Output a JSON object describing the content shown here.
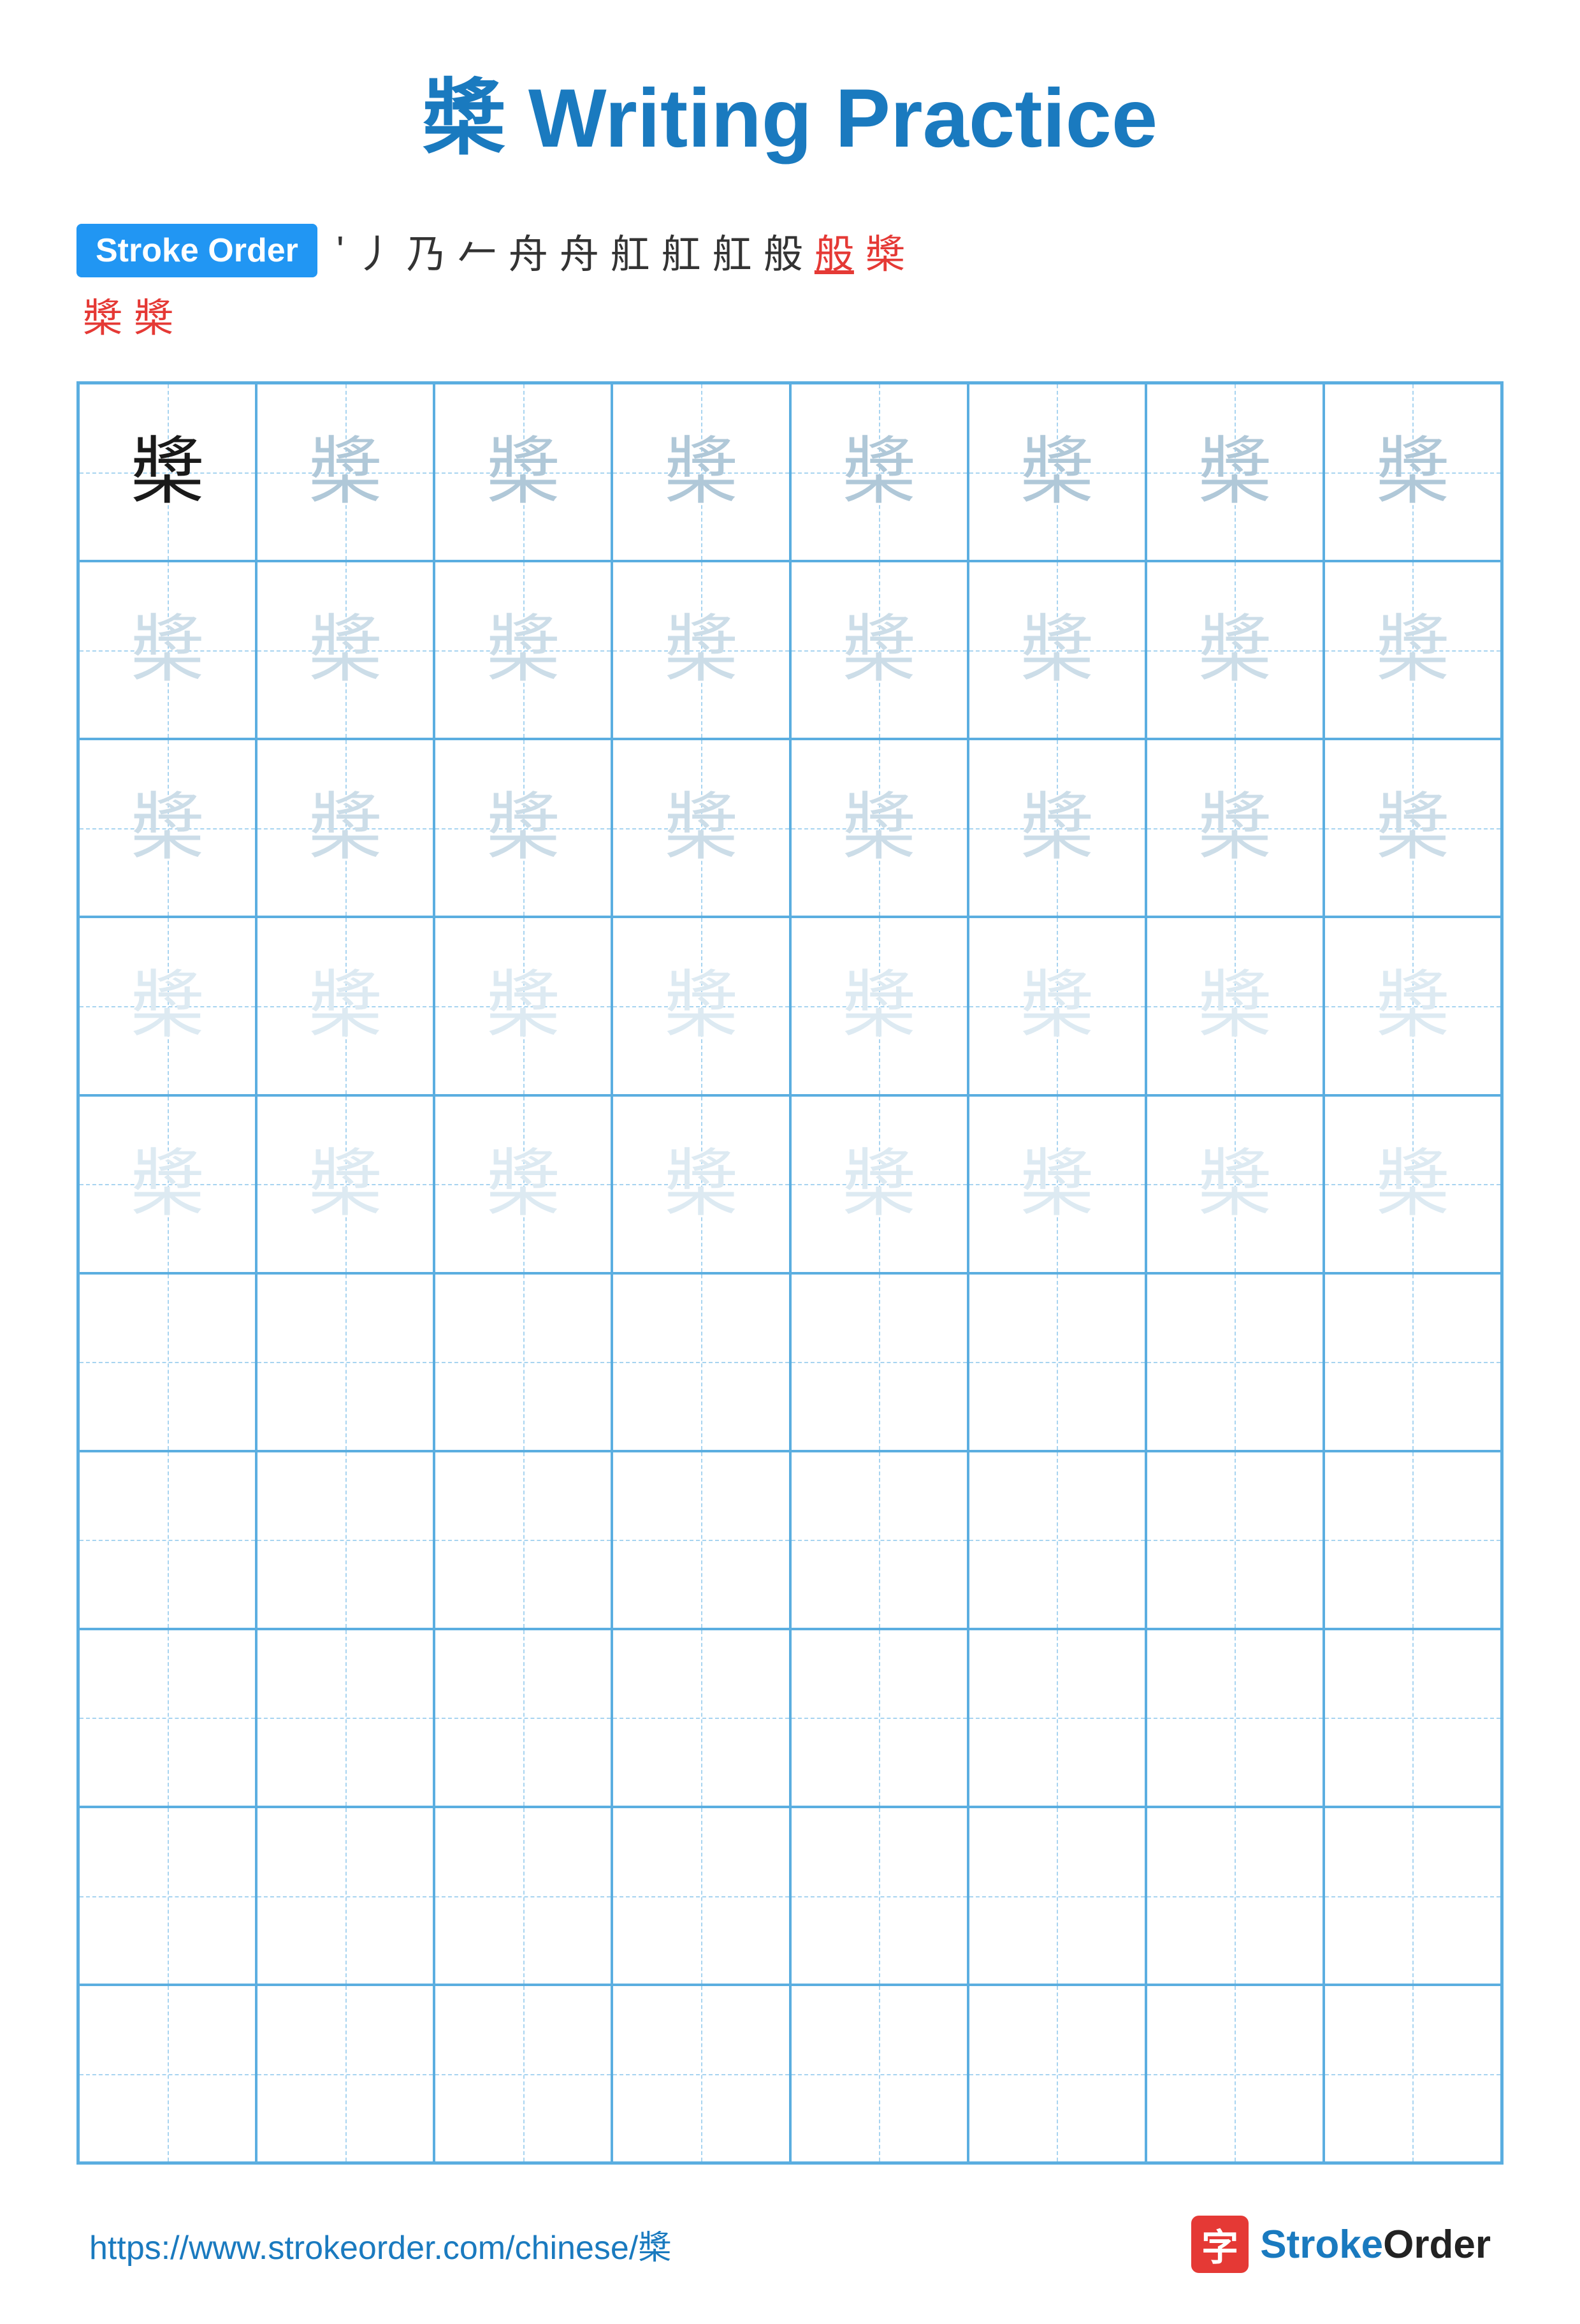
{
  "title": "槳 Writing Practice",
  "stroke_order_label": "Stroke Order",
  "stroke_chars_row1": [
    "'",
    "⼃",
    "乃",
    "𠂉",
    "舟",
    "舟",
    "舡",
    "舡",
    "舡",
    "般",
    "般",
    "槳"
  ],
  "stroke_chars_row2": [
    "槳",
    "槳"
  ],
  "character": "槳",
  "grid_rows": 10,
  "grid_cols": 8,
  "filled_rows": 5,
  "footer_url": "https://www.strokeorder.com/chinese/槳",
  "footer_logo_text": "StrokeOrder"
}
